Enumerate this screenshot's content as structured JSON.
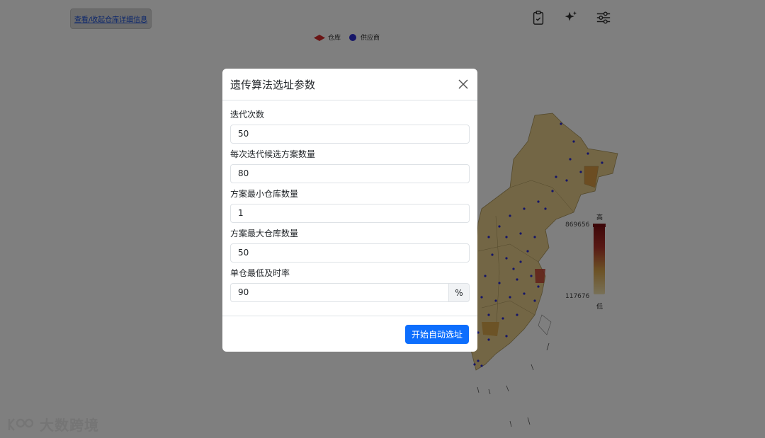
{
  "header": {
    "toggle_link": "查看/收起仓库详细信息"
  },
  "toolbar": {
    "icons": [
      "clipboard-check-icon",
      "sparkles-icon",
      "sliders-icon"
    ]
  },
  "legend": {
    "warehouse": "仓库",
    "supplier": "供应商"
  },
  "visual_map": {
    "max_value": "869656",
    "min_value": "117676",
    "high_label": "高",
    "low_label": "低"
  },
  "watermark": {
    "text": "大数跨境"
  },
  "modal": {
    "title": "遗传算法选址参数",
    "fields": [
      {
        "label": "迭代次数",
        "value": "50"
      },
      {
        "label": "每次迭代候选方案数量",
        "value": "80"
      },
      {
        "label": "方案最小仓库数量",
        "value": "1"
      },
      {
        "label": "方案最大仓库数量",
        "value": "50"
      },
      {
        "label": "单仓最低及时率",
        "value": "90",
        "suffix": "%"
      }
    ],
    "submit_label": "开始自动选址"
  },
  "colors": {
    "primary": "#0d6efd",
    "warehouse_marker": "#d42a2a",
    "supplier_marker": "#2a2ad0",
    "map_high": "#7a0e12",
    "map_low": "#f1e2b0"
  }
}
